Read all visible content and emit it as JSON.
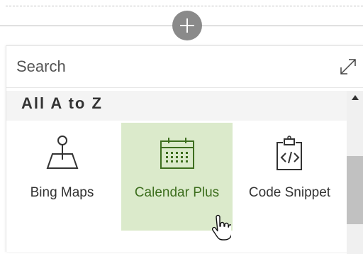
{
  "search": {
    "placeholder": "Search"
  },
  "category": {
    "title": "All A to Z"
  },
  "tiles": [
    {
      "label": "Bing Maps",
      "icon": "map-pin-icon"
    },
    {
      "label": "Calendar Plus",
      "icon": "calendar-icon",
      "selected": true
    },
    {
      "label": "Code Snippet",
      "icon": "code-snippet-icon"
    }
  ],
  "colors": {
    "selected_tile_bg": "#dbeacb",
    "selected_text": "#3d6e1e",
    "add_button": "#8a8a8a"
  }
}
